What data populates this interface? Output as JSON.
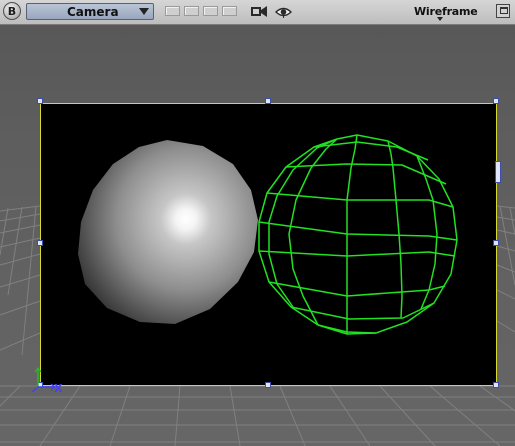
{
  "window": {
    "app_icon_letter": "B",
    "camera_select": {
      "value": "Camera"
    },
    "shading_menu": {
      "value": "Wireframe"
    }
  },
  "icons": {
    "app": "b-logo-icon",
    "camera_dropdown": "chevron-down-icon",
    "camera_view": "video-camera-icon",
    "visibility": "eye-icon",
    "shading_dropdown": "chevron-down-icon",
    "maximize": "maximize-icon"
  },
  "viewport": {
    "axis_label_x": "X",
    "colors": {
      "background": "#5f5f5f",
      "render_frame_border": "#d8d830",
      "render_background": "#000000",
      "wireframe": "#22e022",
      "handles": "#3c4ea8",
      "axis_x": "#4040ff",
      "axis_y": "#20c020"
    }
  }
}
